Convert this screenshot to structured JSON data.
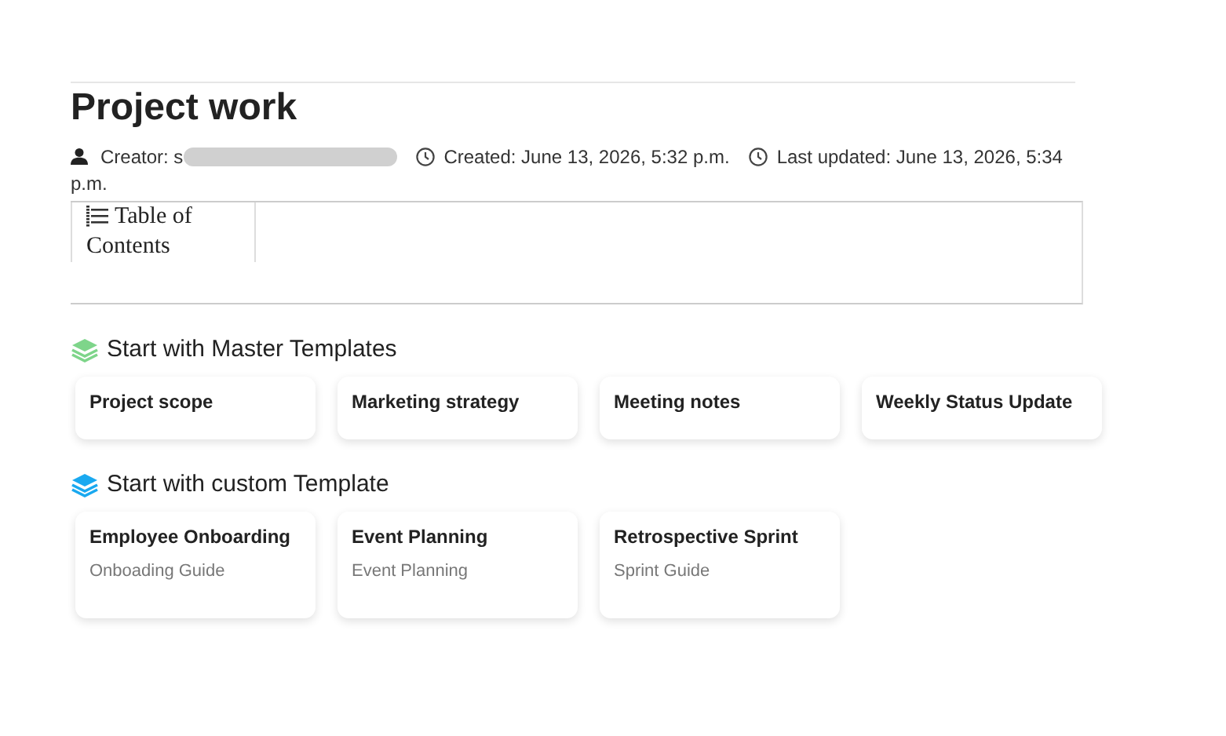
{
  "page": {
    "title": "Project work"
  },
  "meta": {
    "creator": "Creator: s",
    "created": "Created: June 13, 2026, 5:32 p.m.",
    "updated": "Last updated: June 13, 2026, 5:34",
    "updated_wrap": "p.m."
  },
  "toc": {
    "label": "Table of Contents"
  },
  "master_section": {
    "heading": "Start with Master Templates",
    "color": "#7ed58a",
    "cards": [
      {
        "title": "Project scope"
      },
      {
        "title": "Marketing strategy"
      },
      {
        "title": "Meeting notes"
      },
      {
        "title": "Weekly Status Update"
      }
    ]
  },
  "custom_section": {
    "heading": "Start with custom Template",
    "color": "#1aa9f0",
    "cards": [
      {
        "title": "Employee Onboarding",
        "subtitle": "Onboading Guide"
      },
      {
        "title": "Event Planning",
        "subtitle": "Event Planning"
      },
      {
        "title": "Retrospective Sprint",
        "subtitle": "Sprint Guide"
      }
    ]
  }
}
